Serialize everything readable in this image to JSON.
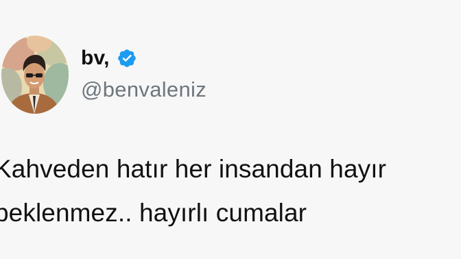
{
  "tweet": {
    "author": {
      "display_name": "bv,",
      "handle": "@benvaleniz",
      "avatar_icon": "profile-photo",
      "verified_icon": "verified-badge-icon"
    },
    "text_lines": [
      "Kahveden hatır her insandan hayır",
      "beklenmez.. hayırlı cumalar"
    ]
  },
  "colors": {
    "background": "#f7f7f7",
    "text": "#111111",
    "handle": "#6e767d",
    "verified_blue": "#1d9bf0"
  }
}
